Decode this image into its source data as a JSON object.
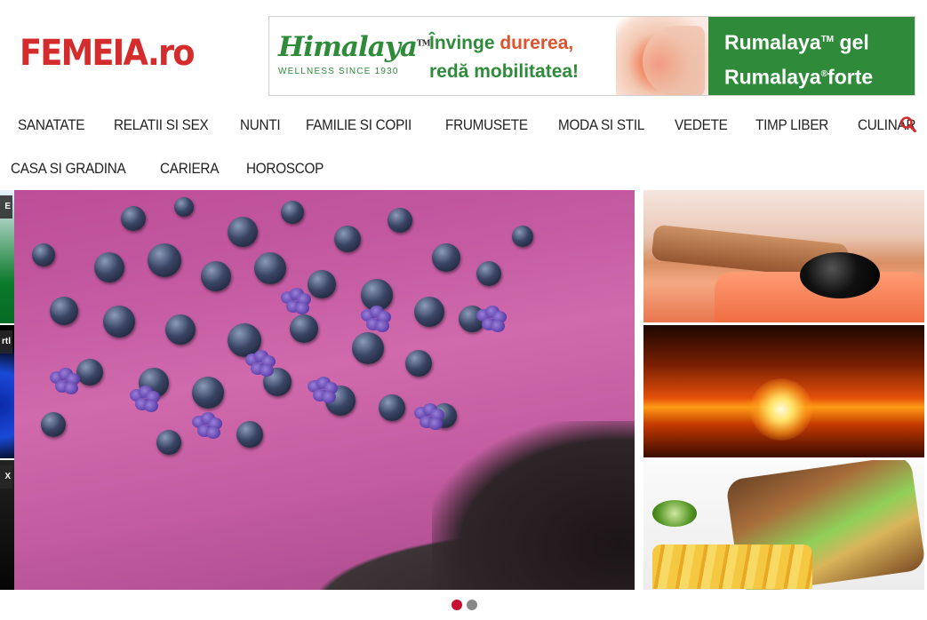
{
  "site": {
    "logo_text": "FEMEIA",
    "logo_suffix": ".ro"
  },
  "banner": {
    "brand": "Himalaya",
    "brand_tm": "TM",
    "brand_tagline": "WELLNESS SINCE 1930",
    "slogan_line1_a": "Învinge ",
    "slogan_line1_b": "durerea,",
    "slogan_line2": "redă mobilitatea!",
    "product1": "Rumalaya",
    "product1_mark": "TM",
    "product1_suffix": " gel",
    "product2": "Rumalaya",
    "product2_mark": "®",
    "product2_suffix": "forte",
    "colors": {
      "green": "#2f8b3a",
      "accent": "#e0522c"
    }
  },
  "nav": {
    "row1": [
      "SANATATE",
      "RELATII SI SEX",
      "NUNTI",
      "FAMILIE SI COPII",
      "FRUMUSETE",
      "MODA SI STIL",
      "VEDETE",
      "TIMP LIBER",
      "CULINAR"
    ],
    "row2": [
      "CASA SI GRADINA",
      "CARIERA",
      "HOROSCOP"
    ],
    "search_icon": "search-icon",
    "accent_color": "#d42c2c"
  },
  "slider": {
    "side_labels": [
      "E",
      "rtl",
      "X"
    ],
    "dots": {
      "total": 2,
      "active_index": 0
    },
    "dot_colors": {
      "active": "#c8102e",
      "inactive": "#888888"
    }
  }
}
